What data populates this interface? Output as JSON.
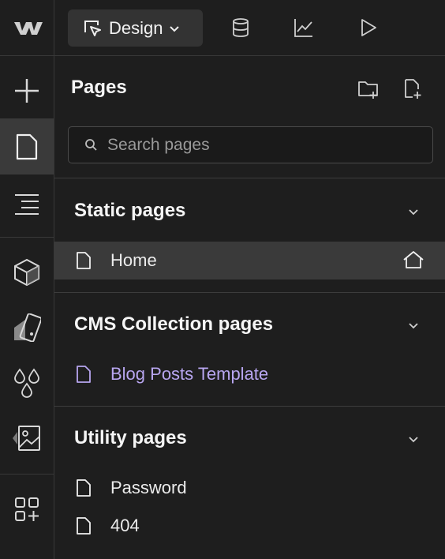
{
  "topbar": {
    "logo": "webflow-logo-icon",
    "mode_button": {
      "label": "Design",
      "icon": "cursor-select-icon"
    },
    "icons": [
      "database-icon",
      "chart-icon",
      "play-icon"
    ]
  },
  "rail": {
    "items": [
      {
        "name": "add-icon"
      },
      {
        "name": "page-icon",
        "active": true
      },
      {
        "name": "navigator-icon"
      },
      {
        "name": "components-icon"
      },
      {
        "name": "styles-icon"
      },
      {
        "name": "variables-icon"
      },
      {
        "name": "assets-icon"
      },
      {
        "name": "apps-icon"
      }
    ]
  },
  "panel": {
    "title": "Pages",
    "search_placeholder": "Search pages",
    "sections": [
      {
        "title": "Static pages",
        "pages": [
          {
            "label": "Home",
            "home": true
          }
        ]
      },
      {
        "title": "CMS Collection pages",
        "pages": [
          {
            "label": "Blog Posts Template"
          }
        ]
      },
      {
        "title": "Utility pages",
        "pages": [
          {
            "label": "Password"
          },
          {
            "label": "404"
          }
        ]
      }
    ]
  },
  "colors": {
    "background": "#1e1e1e",
    "selected_row": "#3a3a3a",
    "cms_accent": "#b8a6f0"
  }
}
